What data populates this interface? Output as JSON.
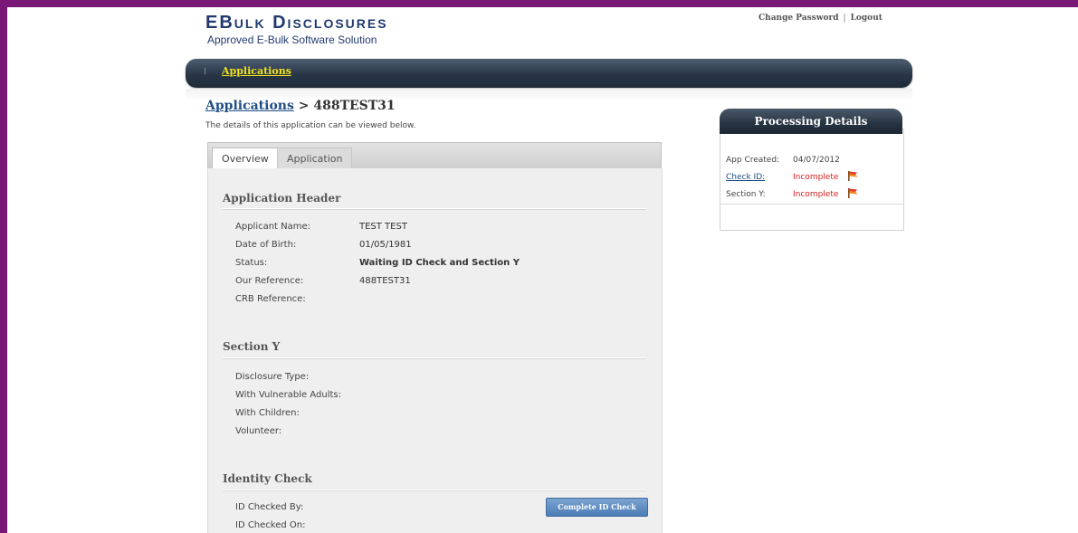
{
  "header": {
    "logo_title": "EBulk Disclosures",
    "logo_subtitle": "Approved E-Bulk Software Solution",
    "change_password": "Change Password",
    "separator": "|",
    "logout": "Logout"
  },
  "nav": {
    "dots": "⁞",
    "applications": "Applications"
  },
  "breadcrumb": {
    "parent": "Applications",
    "separator": " > ",
    "current": "488TEST31"
  },
  "intro_text": "The details of this application can be viewed below.",
  "tabs": [
    {
      "label": "Overview",
      "active": true
    },
    {
      "label": "Application",
      "active": false
    }
  ],
  "application_header": {
    "title": "Application Header",
    "rows": [
      {
        "label": "Applicant Name:",
        "value": "TEST TEST"
      },
      {
        "label": "Date of Birth:",
        "value": "01/05/1981"
      },
      {
        "label": "Status:",
        "value": "Waiting ID Check and Section Y"
      },
      {
        "label": "Our Reference:",
        "value": "488TEST31"
      },
      {
        "label": "CRB Reference:",
        "value": ""
      }
    ]
  },
  "section_y": {
    "title": "Section Y",
    "rows": [
      {
        "label": "Disclosure Type:",
        "value": ""
      },
      {
        "label": "With Vulnerable Adults:",
        "value": ""
      },
      {
        "label": "With Children:",
        "value": ""
      },
      {
        "label": "Volunteer:",
        "value": ""
      }
    ]
  },
  "identity_check": {
    "title": "Identity Check",
    "rows": [
      {
        "label": "ID Checked By:",
        "value": ""
      },
      {
        "label": "ID Checked On:",
        "value": ""
      }
    ],
    "button_label": "Complete ID Check"
  },
  "processing": {
    "title": "Processing Details",
    "rows": [
      {
        "label": "App Created:",
        "value": "04/07/2012"
      },
      {
        "label": "Check ID:",
        "value": "Incomplete",
        "icon": "flag-icon"
      },
      {
        "label": "Section Y:",
        "value": "Incomplete",
        "icon": "flag-icon"
      }
    ]
  },
  "colors": {
    "border": "#7a1877",
    "nav_link": "#f2e21e",
    "incomplete": "#d42020",
    "link": "#1f4d85",
    "flag_red": "#e23b2a",
    "flag_orange": "#f28a1c"
  }
}
